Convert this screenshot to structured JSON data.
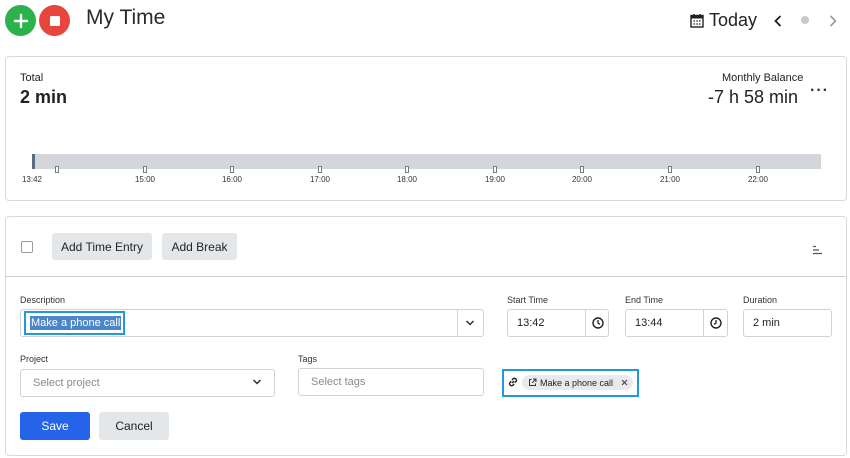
{
  "header": {
    "title": "My Time",
    "today_label": "Today"
  },
  "summary": {
    "total_label": "Total",
    "total_value": "2 min",
    "balance_label": "Monthly Balance",
    "balance_value": "-7 h 58 min",
    "more_label": "···"
  },
  "timeline": {
    "start_label": "13:42",
    "hours": [
      "15:00",
      "16:00",
      "17:00",
      "18:00",
      "19:00",
      "20:00",
      "21:00",
      "22:00"
    ]
  },
  "toolbar": {
    "add_time_entry_label": "Add Time Entry",
    "add_break_label": "Add Break"
  },
  "form": {
    "description_label": "Description",
    "description_value": "Make a phone call",
    "start_time_label": "Start Time",
    "start_time_value": "13:42",
    "end_time_label": "End Time",
    "end_time_value": "13:44",
    "duration_label": "Duration",
    "duration_value": "2 min",
    "project_label": "Project",
    "project_placeholder": "Select project",
    "tags_label": "Tags",
    "tags_placeholder": "Select tags",
    "link_chip_label": "Make a phone call",
    "save_label": "Save",
    "cancel_label": "Cancel"
  },
  "colors": {
    "add": "#2bb24c",
    "stop": "#e8453c",
    "primary": "#2563eb",
    "highlight": "#1f9ad6"
  }
}
